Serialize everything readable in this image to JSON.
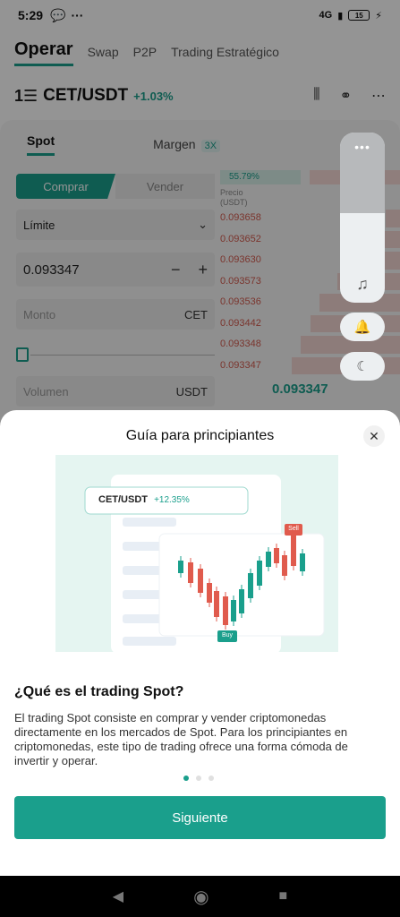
{
  "status_bar": {
    "time": "5:29",
    "network": "4G",
    "battery": "15"
  },
  "top_tabs": [
    "Operar",
    "Swap",
    "P2P",
    "Trading Estratégico"
  ],
  "pair": {
    "logo": "1☰",
    "name": "CET/USDT",
    "change": "+1.03%"
  },
  "sub_tabs": {
    "spot": "Spot",
    "margin": "Margen",
    "margin_badge": "3X"
  },
  "order_form": {
    "buy": "Comprar",
    "sell": "Vender",
    "order_type": "Límite",
    "price": "0.093347",
    "amount_placeholder": "Monto",
    "amount_unit": "CET",
    "volume_placeholder": "Volumen",
    "volume_unit": "USDT"
  },
  "orderbook": {
    "buy_pct": "55.79%",
    "header": "Precio (USDT)",
    "asks": [
      {
        "price": "0.093658",
        "depth": 0.08
      },
      {
        "price": "0.093652",
        "depth": 0.12
      },
      {
        "price": "0.093630",
        "depth": 0.3
      },
      {
        "price": "0.093573",
        "depth": 0.35
      },
      {
        "price": "0.093536",
        "depth": 0.45
      },
      {
        "price": "0.093442",
        "depth": 0.5
      },
      {
        "price": "0.093348",
        "depth": 0.55
      },
      {
        "price": "0.093347",
        "depth": 0.6
      }
    ],
    "last_price": "0.093347"
  },
  "modal": {
    "title": "Guía para principiantes",
    "illustration": {
      "pair": "CET/USDT",
      "change": "+12.35%",
      "sell": "Sell",
      "buy": "Buy"
    },
    "heading": "¿Qué es el trading Spot?",
    "body": "El trading Spot consiste en comprar y vender criptomonedas directamente en los mercados de Spot. Para los principiantes en criptomonedas, este tipo de trading ofrece una forma cómoda de invertir y operar.",
    "pager_total": 3,
    "pager_active": 0,
    "next_button": "Siguiente"
  },
  "colors": {
    "accent": "#1a9f8c",
    "ask": "#d35b4e"
  }
}
